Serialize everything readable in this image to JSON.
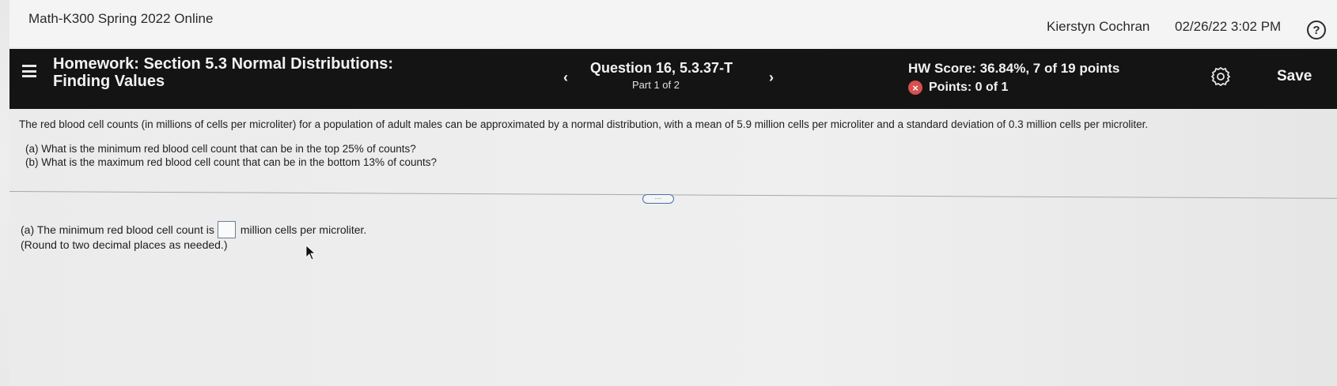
{
  "topbar": {
    "course_title": "Math-K300 Spring 2022 Online",
    "user_name": "Kierstyn Cochran",
    "datetime": "02/26/22 3:02 PM",
    "help_icon": "?"
  },
  "header": {
    "title_line1": "Homework: Section 5.3 Normal Distributions:",
    "title_line2": "Finding Values",
    "prev_icon": "‹",
    "next_icon": "›",
    "question_label": "Question 16, 5.3.37-T",
    "part_label": "Part 1 of 2",
    "hw_score": "HW Score: 36.84%, 7 of 19 points",
    "points": "Points: 0 of 1",
    "points_icon": "x-circle-icon",
    "save_label": "Save"
  },
  "problem": {
    "statement": "The red blood cell counts (in millions of cells per microliter) for a population of adult males can be approximated by a normal distribution, with a mean of 5.9 million cells per microliter and a standard deviation of 0.3 million cells per microliter.",
    "part_a": "(a) What is the minimum red blood cell count that can be in the top 25% of counts?",
    "part_b": "(b) What is the maximum red blood cell count that can be in the bottom 13% of counts?"
  },
  "answer": {
    "prefix": "(a) The minimum red blood cell count is",
    "input_value": "",
    "suffix": "million cells per microliter.",
    "note": "(Round to two decimal places as needed.)"
  },
  "colors": {
    "header_bg": "#141414",
    "error_red": "#d94f4f",
    "input_border": "#6b7d99"
  }
}
